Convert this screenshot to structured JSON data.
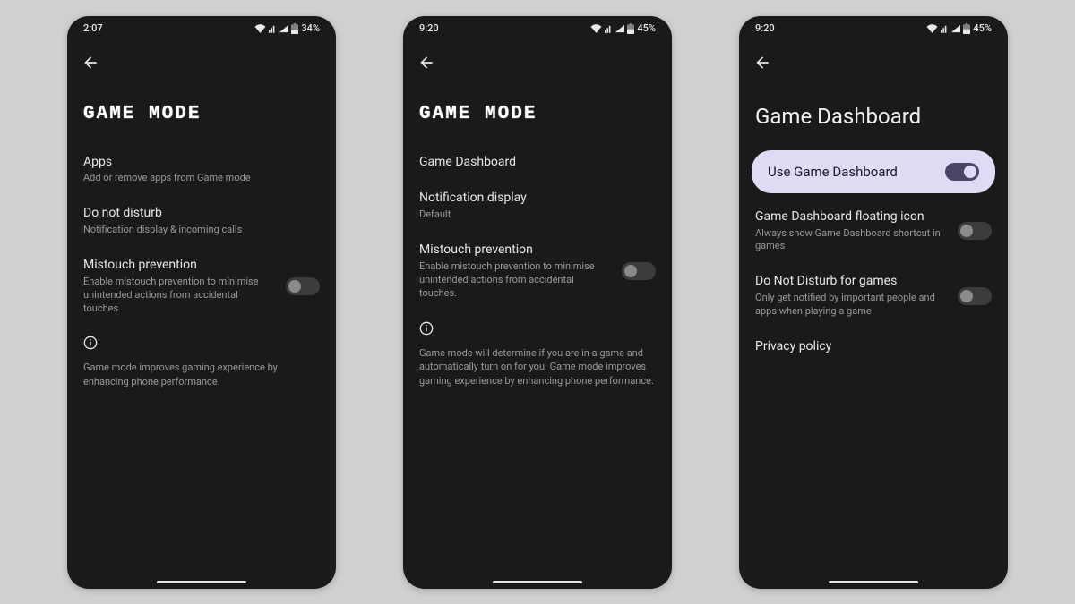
{
  "screens": [
    {
      "status": {
        "time": "2:07",
        "battery": "34%"
      },
      "title": "GAME MODE",
      "title_style": "dots",
      "items": [
        {
          "title": "Apps",
          "sub": "Add or remove apps from Game mode",
          "toggle": null
        },
        {
          "title": "Do not disturb",
          "sub": "Notification display & incoming calls",
          "toggle": null
        },
        {
          "title": "Mistouch prevention",
          "sub": "Enable mistouch prevention to minimise unintended actions from accidental touches.",
          "toggle": "off"
        }
      ],
      "info": "Game mode improves gaming experience by enhancing phone performance."
    },
    {
      "status": {
        "time": "9:20",
        "battery": "45%"
      },
      "title": "GAME MODE",
      "title_style": "dots",
      "items": [
        {
          "title": "Game Dashboard",
          "sub": "",
          "toggle": null
        },
        {
          "title": "Notification display",
          "sub": "Default",
          "toggle": null
        },
        {
          "title": "Mistouch prevention",
          "sub": "Enable mistouch prevention to minimise unintended actions from accidental touches.",
          "toggle": "off"
        }
      ],
      "info": "Game mode will determine if you are in a game and automatically turn on for you. Game mode improves gaming experience by enhancing phone performance."
    },
    {
      "status": {
        "time": "9:20",
        "battery": "45%"
      },
      "title": "Game Dashboard",
      "title_style": "plain",
      "pill": {
        "title": "Use Game Dashboard",
        "toggle": "on"
      },
      "items": [
        {
          "title": "Game Dashboard floating icon",
          "sub": "Always show Game Dashboard shortcut in games",
          "toggle": "off"
        },
        {
          "title": "Do Not Disturb for games",
          "sub": "Only get notified by important people and apps when playing a game",
          "toggle": "off"
        },
        {
          "title": "Privacy policy",
          "sub": "",
          "toggle": null
        }
      ],
      "info": null
    }
  ]
}
